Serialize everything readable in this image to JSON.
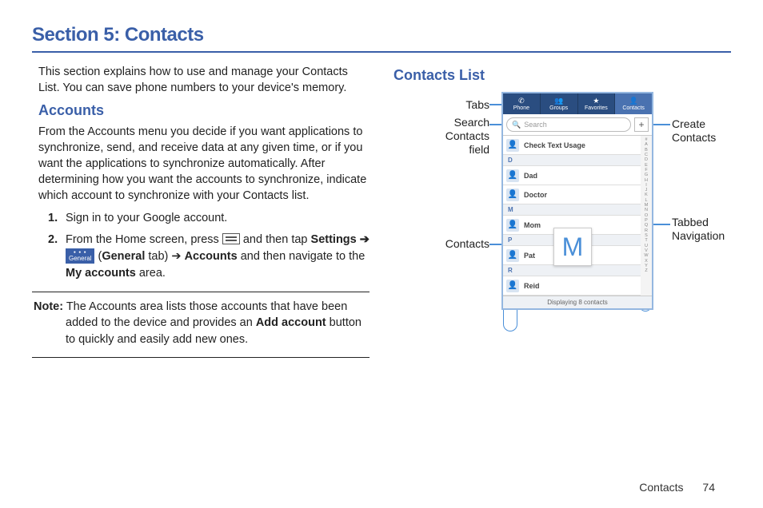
{
  "section_title": "Section 5: Contacts",
  "intro": "This section explains how to use and manage your Contacts List. You can save phone numbers to your device's memory.",
  "accounts": {
    "heading": "Accounts",
    "para": "From the Accounts menu you decide if you want applications to synchronize, send, and receive data at any given time, or if you want the applications to synchronize automatically. After determining how you want the accounts to synchronize, indicate which account to synchronize with your Contacts list.",
    "step1": "Sign in to your Google account.",
    "step2_a": "From the Home screen, press ",
    "step2_b": " and then tap ",
    "step2_settings": "Settings",
    "step2_arrow": " ➔ ",
    "step2_general_label": "General",
    "step2_c": " (",
    "step2_general_tab": "General",
    "step2_d": " tab) ➔ ",
    "step2_accounts": "Accounts",
    "step2_e": " and then navigate to the ",
    "step2_myaccounts": "My accounts",
    "step2_f": " area.",
    "note_label": "Note:",
    "note_a": " The Accounts area lists those accounts that have been added to the device and provides an ",
    "note_add": "Add account",
    "note_b": " button to quickly and easily add new ones."
  },
  "contacts_list": {
    "heading": "Contacts List",
    "callouts": {
      "tabs": "Tabs",
      "search": "Search\nContacts\nfield",
      "contacts": "Contacts",
      "create": "Create\nContacts",
      "tabbed_nav": "Tabbed\nNavigation"
    },
    "phone": {
      "tabs": [
        "Phone",
        "Groups",
        "Favorites",
        "Contacts"
      ],
      "search_placeholder": "Search",
      "first_row": "Check Text Usage",
      "headers": [
        "D",
        "M",
        "P",
        "R"
      ],
      "names": [
        "Dad",
        "Doctor",
        "Mom",
        "Pat",
        "Reid"
      ],
      "status": "Displaying 8 contacts",
      "big_letter": "M",
      "index": [
        "#",
        "A",
        "B",
        "C",
        "D",
        "E",
        "F",
        "G",
        "H",
        "I",
        "J",
        "K",
        "L",
        "M",
        "N",
        "O",
        "P",
        "Q",
        "R",
        "S",
        "T",
        "U",
        "V",
        "W",
        "X",
        "Y",
        "Z"
      ]
    }
  },
  "footer": {
    "chapter": "Contacts",
    "page": "74"
  }
}
